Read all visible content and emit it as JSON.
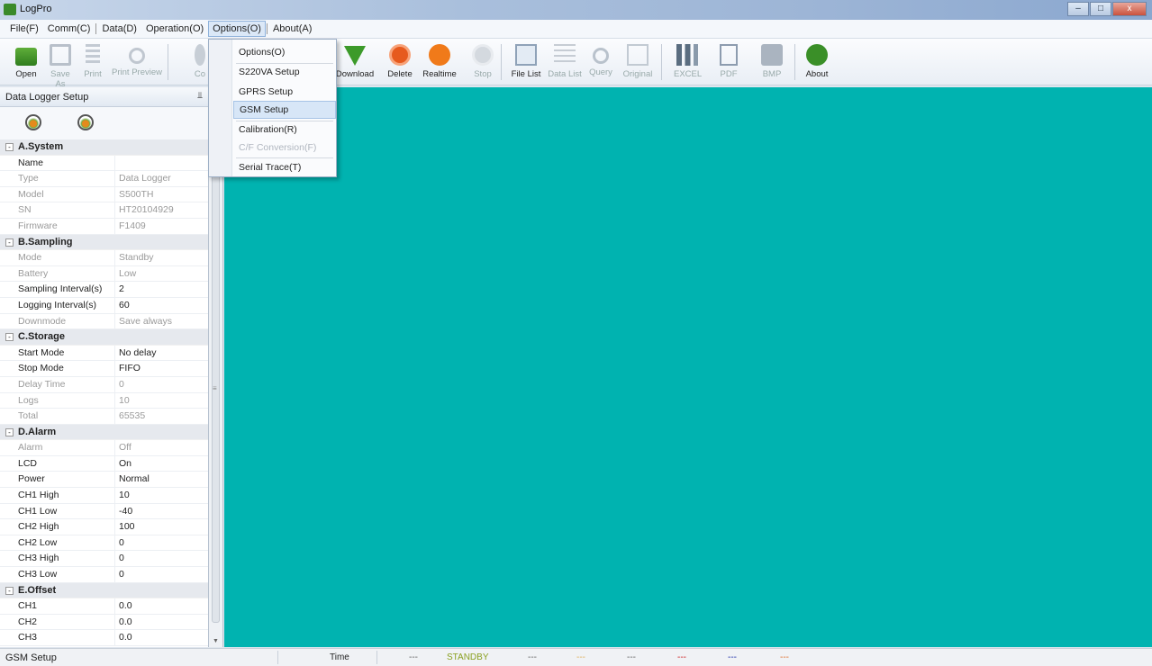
{
  "window": {
    "title": "LogPro",
    "controls": [
      "–",
      "□",
      "x"
    ]
  },
  "menubar": {
    "items": [
      "File(F)",
      "Comm(C)",
      "Data(D)",
      "Operation(O)",
      "Options(O)",
      "About(A)"
    ]
  },
  "toolbar": {
    "open": "Open",
    "save_as": "Save As",
    "print": "Print",
    "print_preview": "Print Preview",
    "co": "Co",
    "download": "Download",
    "delete": "Delete",
    "realtime": "Realtime",
    "stop": "Stop",
    "file_list": "File List",
    "data_list": "Data List",
    "query": "Query",
    "original": "Original",
    "excel": "EXCEL",
    "pdf": "PDF",
    "bmp": "BMP",
    "about": "About"
  },
  "options_menu": {
    "items": [
      "Options(O)",
      "S220VA Setup",
      "GPRS Setup",
      "GSM Setup",
      "Calibration(R)",
      "C/F Conversion(F)",
      "Serial Trace(T)"
    ],
    "highlighted": "GSM Setup"
  },
  "panel": {
    "title": "Data Logger Setup",
    "pin": "⫫",
    "sections": [
      {
        "name": "A.System",
        "rows": [
          {
            "key": "Name",
            "value": ""
          },
          {
            "key": "Type",
            "value": "Data Logger"
          },
          {
            "key": "Model",
            "value": "S500TH"
          },
          {
            "key": "SN",
            "value": "HT20104929"
          },
          {
            "key": "Firmware",
            "value": "F1409"
          }
        ]
      },
      {
        "name": "B.Sampling",
        "rows": [
          {
            "key": "Mode",
            "value": "Standby"
          },
          {
            "key": "Battery",
            "value": "Low"
          },
          {
            "key": "Sampling Interval(s)",
            "value": "2"
          },
          {
            "key": "Logging Interval(s)",
            "value": "60"
          },
          {
            "key": "Downmode",
            "value": "Save always"
          }
        ]
      },
      {
        "name": "C.Storage",
        "rows": [
          {
            "key": "Start Mode",
            "value": "No delay"
          },
          {
            "key": "Stop Mode",
            "value": "FIFO"
          },
          {
            "key": "Delay Time",
            "value": "0"
          },
          {
            "key": "Logs",
            "value": "10"
          },
          {
            "key": "Total",
            "value": "65535"
          }
        ]
      },
      {
        "name": "D.Alarm",
        "rows": [
          {
            "key": "Alarm",
            "value": "Off"
          },
          {
            "key": "LCD",
            "value": "On"
          },
          {
            "key": "Power",
            "value": "Normal"
          },
          {
            "key": "CH1 High",
            "value": "10"
          },
          {
            "key": "CH1 Low",
            "value": "-40"
          },
          {
            "key": "CH2 High",
            "value": "100"
          },
          {
            "key": "CH2 Low",
            "value": "0"
          },
          {
            "key": "CH3 High",
            "value": "0"
          },
          {
            "key": "CH3 Low",
            "value": "0"
          }
        ]
      },
      {
        "name": "E.Offset",
        "rows": [
          {
            "key": "CH1",
            "value": "0.0"
          },
          {
            "key": "CH2",
            "value": "0.0"
          },
          {
            "key": "CH3",
            "value": "0.0"
          }
        ]
      }
    ]
  },
  "workspace": {
    "color": "#00b3b0"
  },
  "statusbar": {
    "left": "GSM Setup",
    "time_label": "Time",
    "items": [
      "---",
      "STANDBY",
      "---",
      "---",
      "---",
      "---",
      "---",
      "---"
    ],
    "item_colors": [
      "#666666",
      "#8aa020",
      "#666666",
      "#e0b060",
      "#666666",
      "#cc2222",
      "#2233aa",
      "#e07030"
    ]
  }
}
